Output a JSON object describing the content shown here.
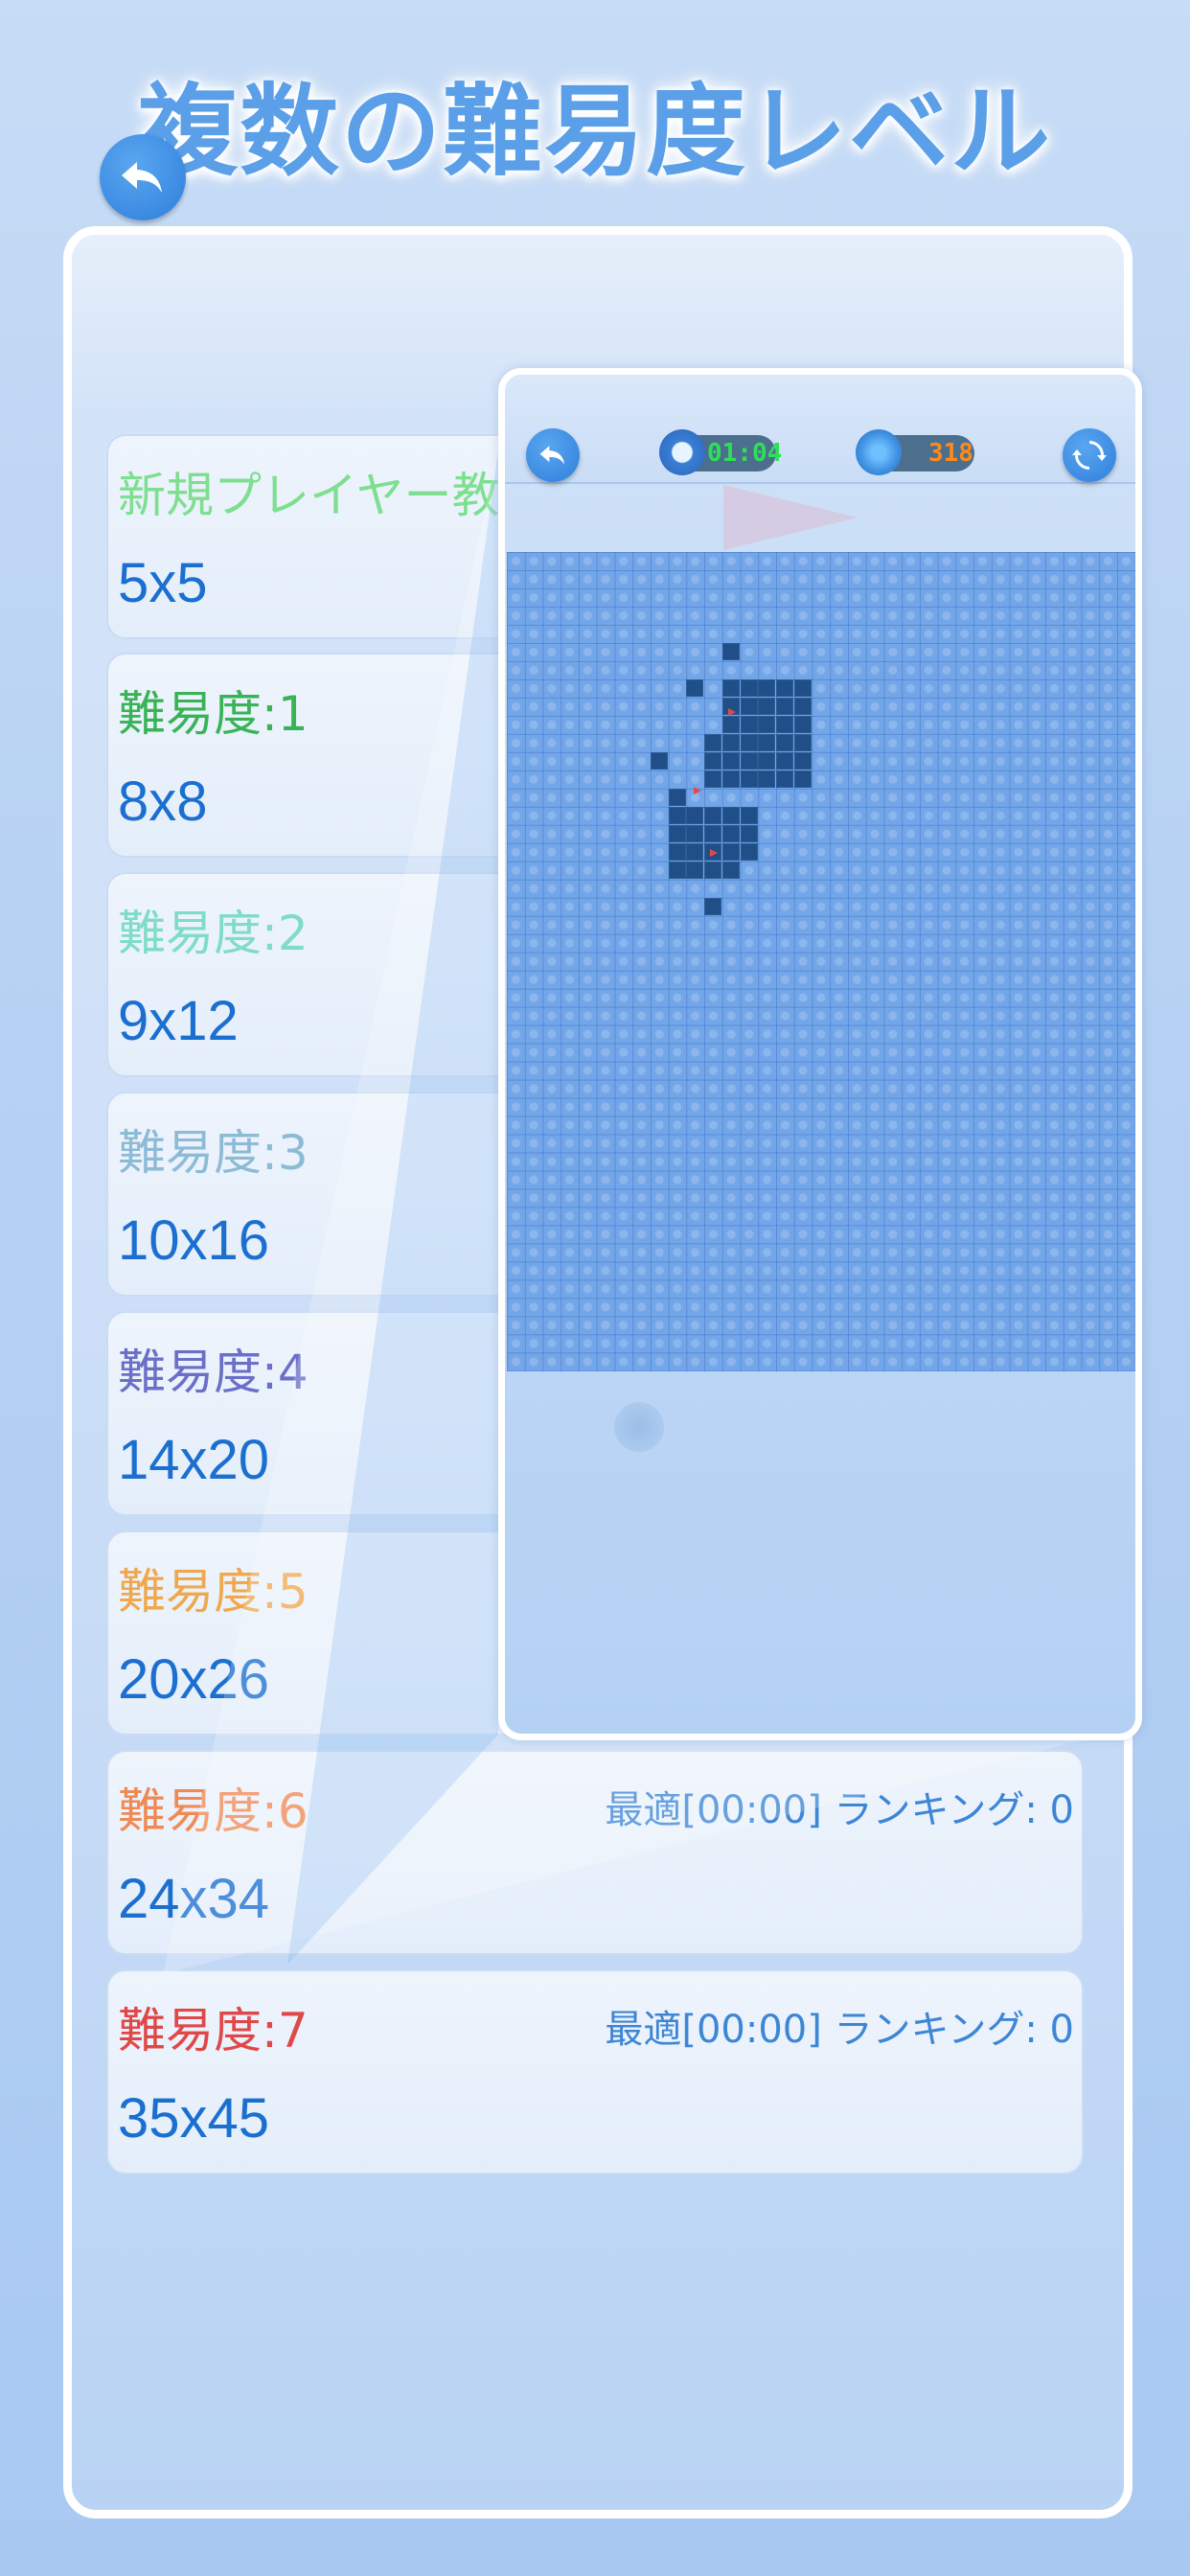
{
  "headline": "複数の難易度レベル",
  "levels": [
    {
      "title": "新規プレイヤー教",
      "size": "5x5",
      "color": "#7ddf8f",
      "best": ""
    },
    {
      "title": "難易度:1",
      "size": "8x8",
      "color": "#38b456",
      "best": ""
    },
    {
      "title": "難易度:2",
      "size": "9x12",
      "color": "#7fdcc6",
      "best": ""
    },
    {
      "title": "難易度:3",
      "size": "10x16",
      "color": "#8dbbd6",
      "best": ""
    },
    {
      "title": "難易度:4",
      "size": "14x20",
      "color": "#6a6fc8",
      "best": ""
    },
    {
      "title": "難易度:5",
      "size": "20x26",
      "color": "#f0a84e",
      "best": ""
    },
    {
      "title": "難易度:6",
      "size": "24x34",
      "color": "#f08a55",
      "best": "最適[00:00] ランキング: 0"
    },
    {
      "title": "難易度:7",
      "size": "35x45",
      "color": "#e04848",
      "best": "最適[00:00] ランキング: 0"
    }
  ],
  "game": {
    "timer": "01:04",
    "mines": "318",
    "icons": {
      "back": "back-arrow-icon",
      "clock": "clock-icon",
      "mine": "virus-icon",
      "restart": "refresh-icon"
    }
  }
}
